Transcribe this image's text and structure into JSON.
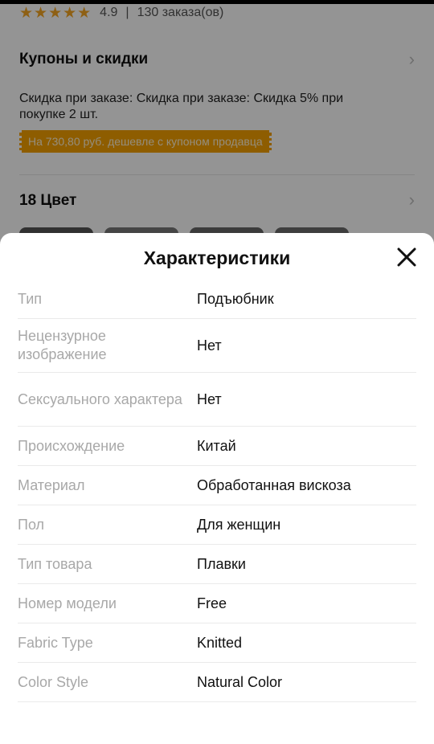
{
  "background": {
    "rating": {
      "stars": "★★★★★",
      "score": "4.9",
      "separator": "|",
      "orders": "130 заказа(ов)"
    },
    "coupons": {
      "title": "Купоны и скидки",
      "discount_text": "Скидка при заказе: Скидка при заказе: Скидка 5% при покупке 2 шт.",
      "coupon_label": "На 730,80 руб. дешевле с купоном продавца"
    },
    "colors": {
      "title": "18 Цвет"
    }
  },
  "sheet": {
    "title": "Характеристики",
    "close_icon": "close-icon",
    "specs": [
      {
        "key": "Тип",
        "value": "Подъюбник"
      },
      {
        "key": "Нецензурное изображение",
        "value": "Нет"
      },
      {
        "key": "Сексуального характера",
        "value": "Нет"
      },
      {
        "key": "Происхождение",
        "value": "Китай"
      },
      {
        "key": "Материал",
        "value": "Обработанная вискоза"
      },
      {
        "key": "Пол",
        "value": "Для женщин"
      },
      {
        "key": "Тип товара",
        "value": "Плавки"
      },
      {
        "key": "Номер модели",
        "value": "Free"
      },
      {
        "key": "Fabric Type",
        "value": "Knitted"
      },
      {
        "key": "Color Style",
        "value": "Natural Color"
      }
    ]
  },
  "colors": {
    "accent": "#f5a000",
    "star": "#f5a623",
    "overlay": "rgba(0,0,0,0.42)"
  }
}
